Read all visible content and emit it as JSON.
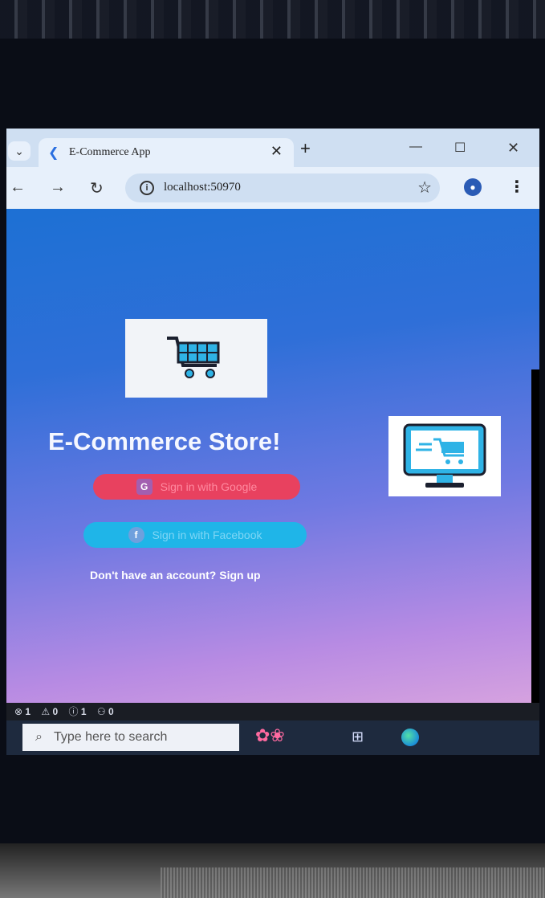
{
  "browser": {
    "tab_title": "E-Commerce App",
    "close_glyph": "✕",
    "new_tab_glyph": "+",
    "url": "localhost:50970"
  },
  "app": {
    "store_title": "E-Commerce Store!",
    "google_button_label": "Sign in with Google",
    "facebook_button_label": "Sign in with Facebook",
    "signup_text": "Don't have an account? Sign up"
  },
  "status_bar": {
    "errors": "1",
    "warnings": "0",
    "infos": "1",
    "ports": "0"
  },
  "taskbar": {
    "search_placeholder": "Type here to search"
  },
  "colors": {
    "google_button": "#e8415f",
    "facebook_button": "#1fb5e8",
    "gradient_top": "#1d70d4",
    "gradient_bottom": "#d6a2df"
  },
  "icons": [
    "flutter-icon",
    "back-arrow-icon",
    "forward-arrow-icon",
    "reload-icon",
    "info-icon",
    "star-icon",
    "profile-icon",
    "menu-icon",
    "cart-icon",
    "google-icon",
    "facebook-icon",
    "monitor-cart-icon",
    "search-icon",
    "edge-icon"
  ]
}
